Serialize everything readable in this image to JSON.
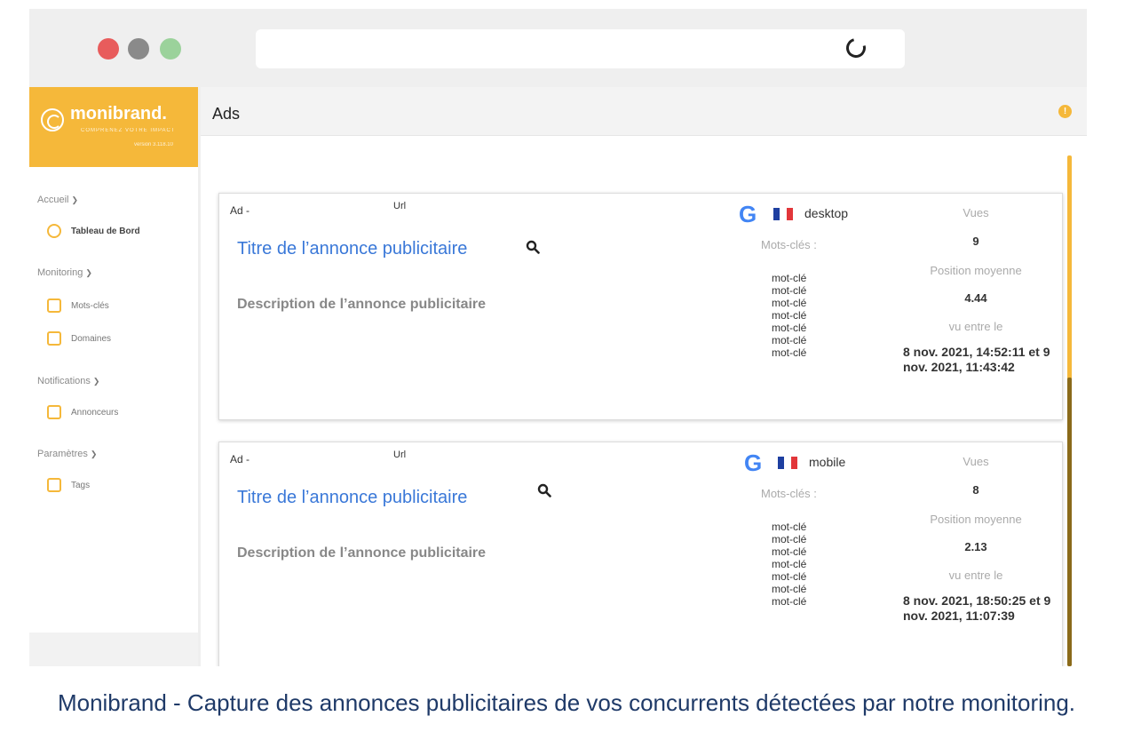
{
  "sidebar": {
    "logo": "monibrand.",
    "tagline": "COMPRENEZ VOTRE IMPACT",
    "version": "version 3.118.10",
    "sections": [
      {
        "label": "Accueil",
        "items": [
          {
            "label": "Tableau de Bord",
            "icon": "dashboard-icon"
          }
        ]
      },
      {
        "label": "Monitoring",
        "items": [
          {
            "label": "Mots-clés",
            "icon": "keywords-icon"
          },
          {
            "label": "Domaines",
            "icon": "domains-icon"
          }
        ]
      },
      {
        "label": "Notifications",
        "items": [
          {
            "label": "Annonceurs",
            "icon": "advertisers-icon"
          }
        ]
      },
      {
        "label": "Paramètres",
        "items": [
          {
            "label": "Tags",
            "icon": "tags-icon"
          }
        ]
      }
    ]
  },
  "main": {
    "title": "Ads",
    "ads": [
      {
        "ad_label": "Ad -",
        "url_label": "Url",
        "title": "Titre de l’annonce publicitaire",
        "description": "Description de l’annonce publicitaire",
        "device": "desktop",
        "keywords_label": "Mots-clés :",
        "keywords": [
          "mot-clé",
          "mot-clé",
          "mot-clé",
          "mot-clé",
          "mot-clé",
          "mot-clé",
          "mot-clé"
        ],
        "views_label": "Vues",
        "views": "9",
        "avg_position_label": "Position moyenne",
        "avg_position": "4.44",
        "seen_between_label": "vu entre le",
        "seen_between": "8 nov. 2021, 14:52:11 et 9 nov. 2021, 11:43:42"
      },
      {
        "ad_label": "Ad -",
        "url_label": "Url",
        "title": "Titre de l’annonce publicitaire",
        "description": "Description de l’annonce publicitaire",
        "device": "mobile",
        "keywords_label": "Mots-clés :",
        "keywords": [
          "mot-clé",
          "mot-clé",
          "mot-clé",
          "mot-clé",
          "mot-clé",
          "mot-clé",
          "mot-clé"
        ],
        "views_label": "Vues",
        "views": "8",
        "avg_position_label": "Position moyenne",
        "avg_position": "2.13",
        "seen_between_label": "vu entre le",
        "seen_between": "8 nov. 2021, 18:50:25 et 9 nov. 2021, 11:07:39"
      }
    ]
  },
  "colors": {
    "brand": "#f5b83a",
    "link": "#3a78d8",
    "caption": "#1f3a68"
  },
  "caption": "Monibrand - Capture des annonces publicitaires de vos concurrents détectées par notre monitoring."
}
